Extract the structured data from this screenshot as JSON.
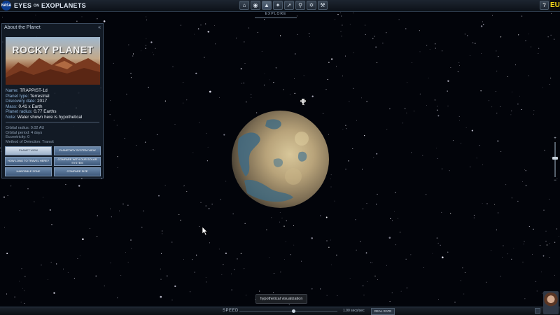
{
  "app": {
    "brand_main": "EYES",
    "brand_small": "ON",
    "brand_end": "EXOPLANETS",
    "nasa_label": "NASA"
  },
  "nav": {
    "icons": [
      "home-icon",
      "globe-icon",
      "planets-icon",
      "planet-system-icon",
      "telescope-icon",
      "search-icon",
      "satellite-icon",
      "wrench-icon"
    ],
    "mode_label": "EXPLORE",
    "help_label": "?",
    "edge_badge": "EU"
  },
  "panel": {
    "title": "About the Planet",
    "collapse_label": "«",
    "hero_title": "ROCKY PLANET",
    "facts": [
      {
        "label": "Name:",
        "value": "TRAPPIST-1d"
      },
      {
        "label": "Planet type:",
        "value": "Terrestrial"
      },
      {
        "label": "Discovery date:",
        "value": "2017"
      },
      {
        "label": "Mass:",
        "value": "0.41 x Earth"
      },
      {
        "label": "Planet radius:",
        "value": "0.77 Earths"
      },
      {
        "label": "Note:",
        "value": "Water shown here is hypothetical"
      }
    ],
    "orbital": [
      "Orbital radius: 0.02 AU",
      "Orbital period: 4 days",
      "Eccentricity: 0",
      "Method of Detection: Transit"
    ],
    "buttons": [
      {
        "label": "PLANET VIEW",
        "selected": true
      },
      {
        "label": "PLANETARY SYSTEM VIEW",
        "selected": false
      },
      {
        "label": "HOW LONG TO TRAVEL HERE?",
        "selected": false
      },
      {
        "label": "COMPARE WITH OUR SOLAR SYSTEM",
        "selected": false
      },
      {
        "label": "HABITABLE ZONE",
        "selected": false
      },
      {
        "label": "COMPARE SIZE",
        "selected": false
      }
    ]
  },
  "zoom": {
    "plus": "+",
    "minus": "−",
    "level": 0.45
  },
  "tooltip": "hypothetical visualization",
  "bottom": {
    "speed_label": "SPEED",
    "speed_value": "1.00 secs/sec",
    "real_rate_label": "REAL RATE",
    "speed_level": 0.55
  },
  "colors": {
    "panel_bg": "#141c28",
    "accent": "#6b88aa",
    "space": "#02040a"
  }
}
